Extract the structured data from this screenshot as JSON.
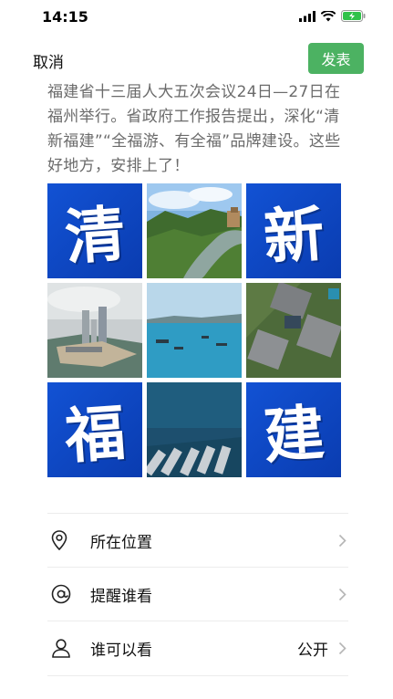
{
  "status": {
    "time": "14:15"
  },
  "nav": {
    "cancel_label": "取消",
    "publish_label": "发表"
  },
  "post": {
    "text": "福建省十三届人大五次会议24日—27日在福州举行。省政府工作报告提出，深化“清新福建”“全福游、有全福”品牌建设。这些好地方，安排上了！"
  },
  "grid": {
    "characters": {
      "qing": "清",
      "xin": "新",
      "fu": "福",
      "jian": "建"
    }
  },
  "options": {
    "location": {
      "label": "所在位置",
      "icon": "location-pin-icon"
    },
    "remind": {
      "label": "提醒谁看",
      "icon": "at-icon"
    },
    "visibility": {
      "label": "谁可以看",
      "value": "公开",
      "icon": "person-icon"
    }
  },
  "colors": {
    "accent": "#4cb262",
    "tile_blue": "#1252d4"
  }
}
